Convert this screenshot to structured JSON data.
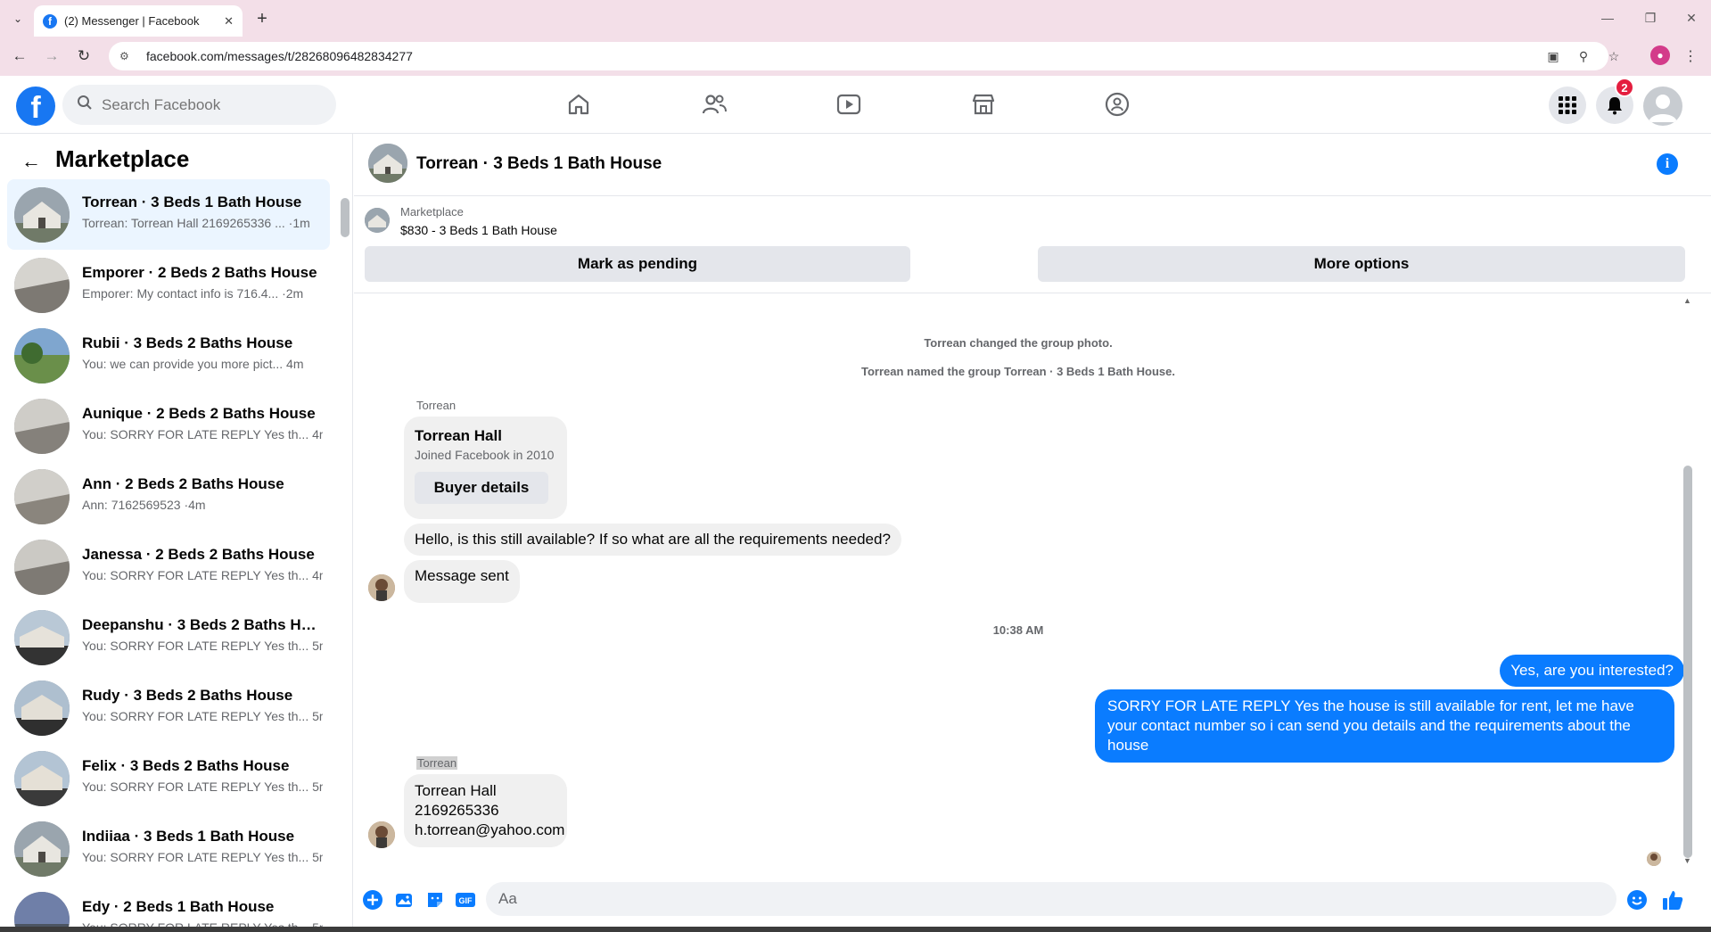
{
  "browser": {
    "tab_title": "(2) Messenger | Facebook",
    "url": "facebook.com/messages/t/28268096482834277"
  },
  "header": {
    "search_placeholder": "Search Facebook",
    "notification_count": "2"
  },
  "sidebar": {
    "title": "Marketplace",
    "conversations": [
      {
        "name": "Torrean · 3 Beds 1 Bath House",
        "preview": "Torrean: Torrean Hall 2169265336 ... ·1m",
        "active": true
      },
      {
        "name": "Emporer · 2 Beds 2 Baths House",
        "preview": "Emporer: My contact info is 716.4... ·2m"
      },
      {
        "name": "Rubii · 3 Beds 2 Baths House",
        "preview": "You: we can provide you more pict... 4m"
      },
      {
        "name": "Aunique · 2 Beds 2 Baths House",
        "preview": "You: SORRY FOR LATE REPLY Yes th... 4m"
      },
      {
        "name": "Ann · 2 Beds 2 Baths House",
        "preview": "Ann: 7162569523 ·4m"
      },
      {
        "name": "Janessa · 2 Beds 2 Baths House",
        "preview": "You: SORRY FOR LATE REPLY Yes th... 4m"
      },
      {
        "name": "Deepanshu · 3 Beds 2 Baths Hou...",
        "preview": "You: SORRY FOR LATE REPLY Yes th... 5m"
      },
      {
        "name": "Rudy · 3 Beds 2 Baths House",
        "preview": "You: SORRY FOR LATE REPLY Yes th... 5m"
      },
      {
        "name": "Felix · 3 Beds 2 Baths House",
        "preview": "You: SORRY FOR LATE REPLY Yes th... 5m"
      },
      {
        "name": "Indiiaa · 3 Beds 1 Bath House",
        "preview": "You: SORRY FOR LATE REPLY Yes th... 5m"
      },
      {
        "name": "Edy · 2 Beds 1 Bath House",
        "preview": "You: SORRY FOR LATE REPLY Yes th... 5m"
      }
    ]
  },
  "chat": {
    "title": "Torrean · 3 Beds 1 Bath House",
    "listing_source": "Marketplace",
    "listing_title": "$830 - 3 Beds 1 Bath House",
    "mark_pending": "Mark as pending",
    "more_options": "More options",
    "system_1": "Torrean changed the group photo.",
    "system_2": "Torrean named the group Torrean · 3 Beds 1 Bath House.",
    "sender_1": "Torrean",
    "card_name": "Torrean Hall",
    "card_joined": "Joined Facebook in 2010",
    "card_button": "Buyer details",
    "msg_1": "Hello, is this still available? If so what are all the requirements needed?",
    "msg_2": "Message sent",
    "timestamp": "10:38 AM",
    "out_1": "Yes, are you interested?",
    "out_2": "SORRY FOR LATE REPLY Yes the house is still available for rent, let me have your contact number so i can send you details and the requirements about the house",
    "sender_2": "Torrean",
    "in_3_line1": "Torrean Hall",
    "in_3_line2": "2169265336",
    "in_3_line3": "h.torrean@yahoo.com"
  },
  "composer": {
    "placeholder": "Aa"
  },
  "colors": {
    "brand": "#1877f2",
    "outgoing_bubble": "#0a7cff",
    "active_row": "#ebf5ff",
    "badge": "#e41e3f"
  }
}
